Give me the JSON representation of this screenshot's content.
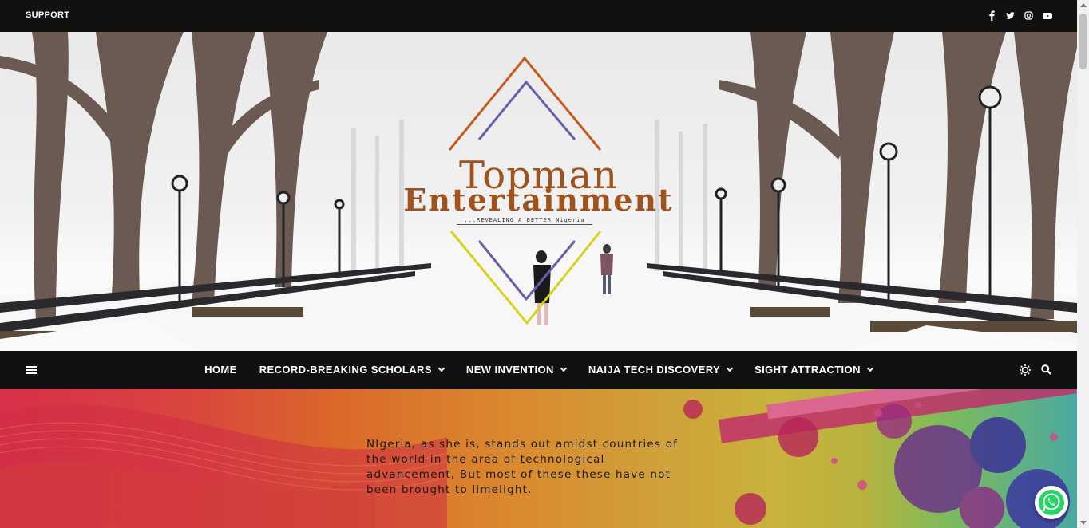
{
  "topbar": {
    "support_label": "SUPPORT",
    "social_icons": [
      "facebook-icon",
      "twitter-icon",
      "instagram-icon",
      "youtube-icon"
    ]
  },
  "logo": {
    "line1": "Topman",
    "line2": "Entertainment",
    "tagline": "...REVEALING A BETTER Nigeria"
  },
  "nav": {
    "items": [
      {
        "label": "HOME",
        "has_dropdown": false
      },
      {
        "label": "RECORD-BREAKING SCHOLARS",
        "has_dropdown": true
      },
      {
        "label": "NEW INVENTION",
        "has_dropdown": true
      },
      {
        "label": "NAIJA TECH DISCOVERY",
        "has_dropdown": true
      },
      {
        "label": "SIGHT ATTRACTION",
        "has_dropdown": true
      }
    ],
    "tools": [
      "brightness-icon",
      "search-icon"
    ]
  },
  "banner": {
    "text": "NIgeria, as she is, stands out amidst countries of the world in the area of technological advancement, But most of these these have not been brought to limelight."
  },
  "colors": {
    "bar_bg": "#111111",
    "logo_brown": "#a0521c",
    "diamond_orange": "#c65a1e",
    "diamond_purple": "#6b5ea8",
    "diamond_yellow": "#d9d21a",
    "whatsapp_green": "#25d366"
  }
}
